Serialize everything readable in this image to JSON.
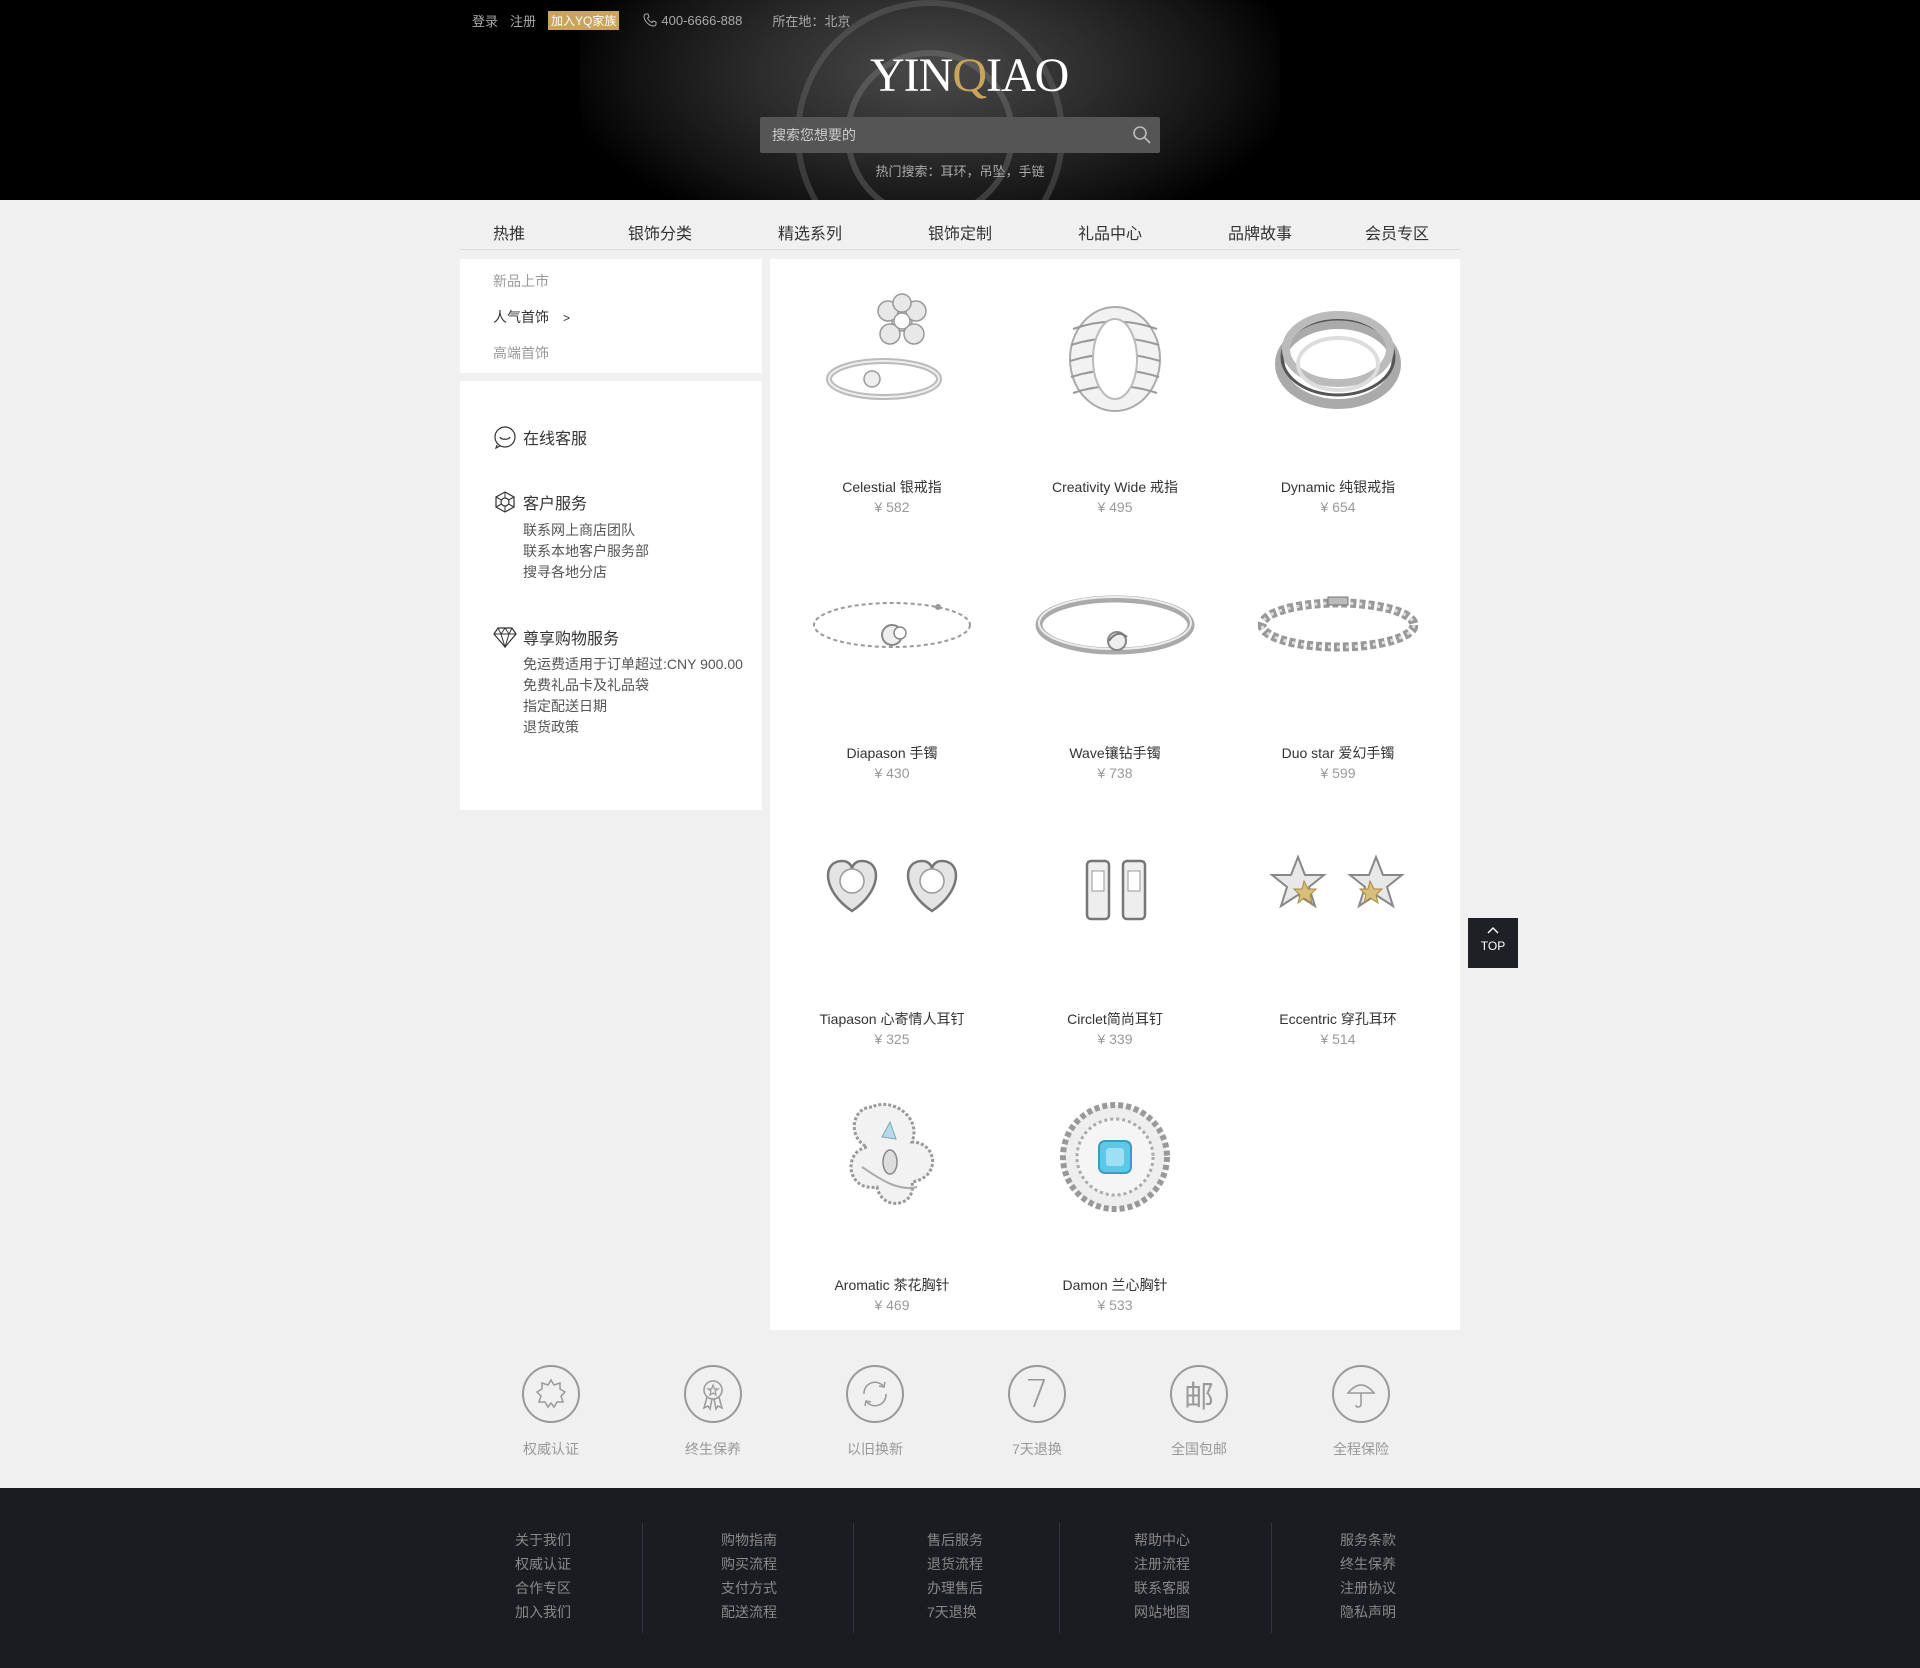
{
  "header": {
    "topbar": {
      "login": "登录",
      "register": "注册",
      "join": "加入YQ家族",
      "phone": "400-6666-888",
      "location": "所在地：北京"
    },
    "logo": {
      "part1": "YIN",
      "q": "Q",
      "part2": "IAO"
    },
    "search": {
      "placeholder": "搜索您想要的"
    },
    "hot_search": "热门搜索：耳环，吊坠，手链"
  },
  "nav": [
    "热推",
    "银饰分类",
    "精选系列",
    "银饰定制",
    "礼品中心",
    "品牌故事",
    "会员专区"
  ],
  "sidebar": {
    "categories": [
      {
        "label": "新品上市",
        "active": false
      },
      {
        "label": "人气首饰",
        "active": true,
        "arrow": ">"
      },
      {
        "label": "高端首饰",
        "active": false
      }
    ],
    "services": [
      {
        "title": "在线客服",
        "icon": "chat-bubble-icon",
        "lines": []
      },
      {
        "title": "客户服务",
        "icon": "cube-icon",
        "lines": [
          "联系网上商店团队",
          "联系本地客户服务部",
          "搜寻各地分店"
        ]
      },
      {
        "title": "尊享购物服务",
        "icon": "diamond-icon",
        "lines": [
          "免运费适用于订单超过:CNY 900.00",
          "免费礼品卡及礼品袋",
          "指定配送日期",
          "退货政策"
        ]
      }
    ]
  },
  "products": [
    {
      "name": "Celestial 银戒指",
      "price": "¥ 582",
      "icon": "flower-ring-icon"
    },
    {
      "name": "Creativity Wide 戒指",
      "price": "¥ 495",
      "icon": "wide-ring-icon"
    },
    {
      "name": "Dynamic 纯银戒指",
      "price": "¥ 654",
      "icon": "spiral-ring-icon"
    },
    {
      "name": "Diapason 手镯",
      "price": "¥ 430",
      "icon": "chain-bracelet-icon"
    },
    {
      "name": "Wave镶钻手镯",
      "price": "¥ 738",
      "icon": "bangle-icon"
    },
    {
      "name": "Duo star 爱幻手镯",
      "price": "¥ 599",
      "icon": "tennis-bracelet-icon"
    },
    {
      "name": "Tiapason 心寄情人耳钉",
      "price": "¥ 325",
      "icon": "heart-earrings-icon"
    },
    {
      "name": "Circlet简尚耳钉",
      "price": "¥ 339",
      "icon": "hoop-earrings-icon"
    },
    {
      "name": "Eccentric 穿孔耳环",
      "price": "¥ 514",
      "icon": "star-earrings-icon"
    },
    {
      "name": "Aromatic 茶花胸针",
      "price": "¥ 469",
      "icon": "flower-brooch-icon"
    },
    {
      "name": "Damon  兰心胸针",
      "price": "¥ 533",
      "icon": "blue-brooch-icon"
    }
  ],
  "top_button": "TOP",
  "features": [
    {
      "label": "权威认证",
      "icon": "badge-icon"
    },
    {
      "label": "终生保养",
      "icon": "award-icon"
    },
    {
      "label": "以旧换新",
      "icon": "refresh-icon"
    },
    {
      "label": "7天退换",
      "icon": "seven-icon",
      "glyph": "7"
    },
    {
      "label": "全国包邮",
      "icon": "mail-icon",
      "glyph": "邮"
    },
    {
      "label": "全程保险",
      "icon": "umbrella-icon"
    }
  ],
  "footer": [
    [
      "关于我们",
      "权威认证",
      "合作专区",
      "加入我们"
    ],
    [
      "购物指南",
      "购买流程",
      "支付方式",
      "配送流程"
    ],
    [
      "售后服务",
      "退货流程",
      "办理售后",
      "7天退换"
    ],
    [
      "帮助中心",
      "注册流程",
      "联系客服",
      "网站地图"
    ],
    [
      "服务条款",
      "终生保养",
      "注册协议",
      "隐私声明"
    ]
  ],
  "colors": {
    "gold": "#c9a45a",
    "dark": "#1b1c22",
    "bg": "#f0f0f0",
    "gem_blue": "#5ec8e8"
  }
}
